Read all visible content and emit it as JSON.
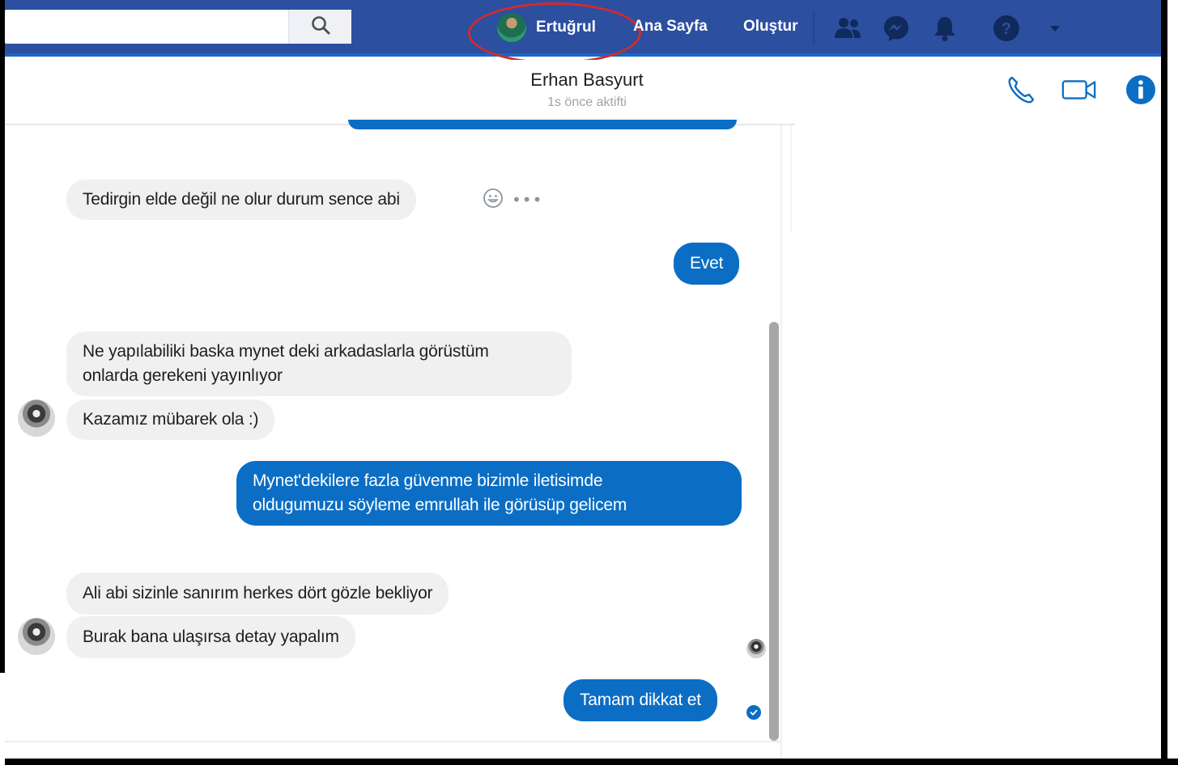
{
  "topbar": {
    "profile_name": "Ertuğrul",
    "home_label": "Ana Sayfa",
    "create_label": "Oluştur",
    "color": "#2c4fa0",
    "icons": [
      "search-icon",
      "friends-icon",
      "messenger-icon",
      "notifications-icon",
      "help-icon",
      "dropdown-icon"
    ]
  },
  "conversation": {
    "contact_name": "Erhan Basyurt",
    "status": "1s önce aktifti",
    "header_icons": [
      "phone-icon",
      "video-icon",
      "info-icon"
    ],
    "accent_color": "#0b6ec4",
    "messages": [
      {
        "side": "in",
        "text": "Tedirgin elde değil ne olur durum sence abi"
      },
      {
        "side": "out",
        "text": "Evet"
      },
      {
        "side": "in",
        "text": "Ne yapılabiliki baska mynet deki arkadaslarla görüstüm onlarda gerekeni yayınlıyor",
        "lines": [
          "Ne yapılabiliki baska mynet deki arkadaslarla görüstüm",
          "onlarda gerekeni yayınlıyor"
        ]
      },
      {
        "side": "in",
        "text": "Kazamız mübarek ola :)"
      },
      {
        "side": "out",
        "text": "Mynet'dekilere fazla güvenme bizimle iletisimde oldugumuzu söyleme emrullah ile görüsüp gelicem",
        "lines": [
          "Mynet'dekilere fazla güvenme bizimle iletisimde",
          "oldugumuzu söyleme emrullah ile görüsüp gelicem"
        ]
      },
      {
        "side": "in",
        "text": "Ali abi sizinle sanırım herkes dört gözle bekliyor"
      },
      {
        "side": "in",
        "text": "Burak bana ulaşırsa detay yapalım"
      },
      {
        "side": "out",
        "text": "Tamam dikkat et"
      }
    ]
  }
}
